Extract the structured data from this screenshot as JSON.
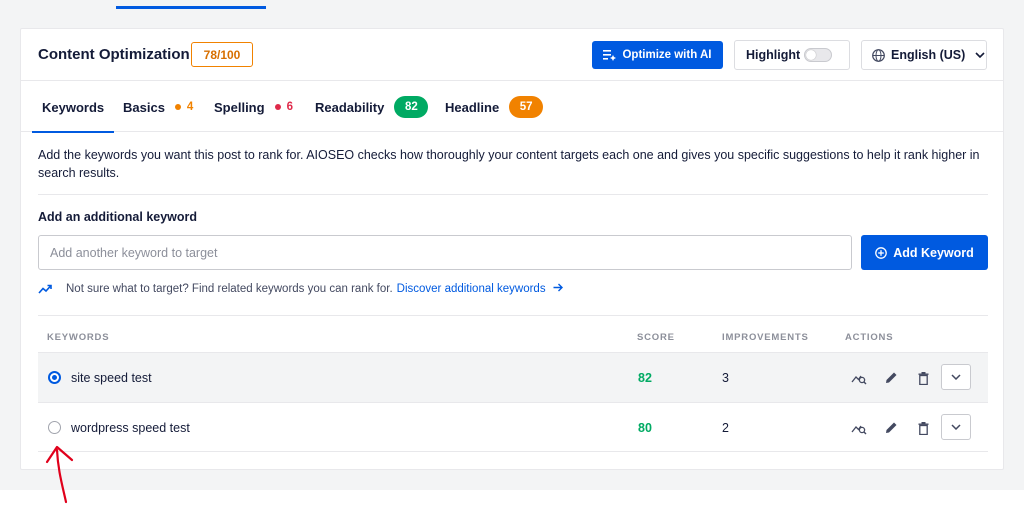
{
  "header": {
    "title": "Content Optimization",
    "score": "78/100",
    "optimize_label": "Optimize with AI",
    "highlight_label": "Highlight",
    "language_label": "English (US)"
  },
  "tabs": [
    {
      "label": "Keywords",
      "active": true
    },
    {
      "label": "Basics",
      "count": "4"
    },
    {
      "label": "Spelling",
      "count": "6"
    },
    {
      "label": "Readability",
      "score": "82"
    },
    {
      "label": "Headline",
      "score": "57"
    }
  ],
  "description": "Add the keywords you want this post to rank for. AIOSEO checks how thoroughly your content targets each one and gives you specific suggestions to help it rank higher in search results.",
  "add_keyword": {
    "label": "Add an additional keyword",
    "placeholder": "Add another keyword to target",
    "button_label": "Add Keyword"
  },
  "hint": {
    "text": "Not sure what to target? Find related keywords you can rank for.",
    "link": "Discover additional keywords"
  },
  "table": {
    "headers": {
      "keywords": "KEYWORDS",
      "score": "SCORE",
      "improvements": "IMPROVEMENTS",
      "actions": "ACTIONS"
    },
    "rows": [
      {
        "keyword": "site speed test",
        "score": "82",
        "improvements": "3",
        "selected": true
      },
      {
        "keyword": "wordpress speed test",
        "score": "80",
        "improvements": "2",
        "selected": false
      }
    ]
  },
  "colors": {
    "primary": "#005ae0",
    "green": "#00aa63",
    "orange": "#f18200",
    "red": "#df2a4a",
    "annotation": "#e0001b"
  },
  "icons": [
    "ai-list-icon",
    "globe-icon",
    "chevron-down-icon",
    "plus-circle-icon",
    "trend-up-icon",
    "arrow-right-icon",
    "keyword-analysis-icon",
    "pencil-icon",
    "trash-icon"
  ]
}
